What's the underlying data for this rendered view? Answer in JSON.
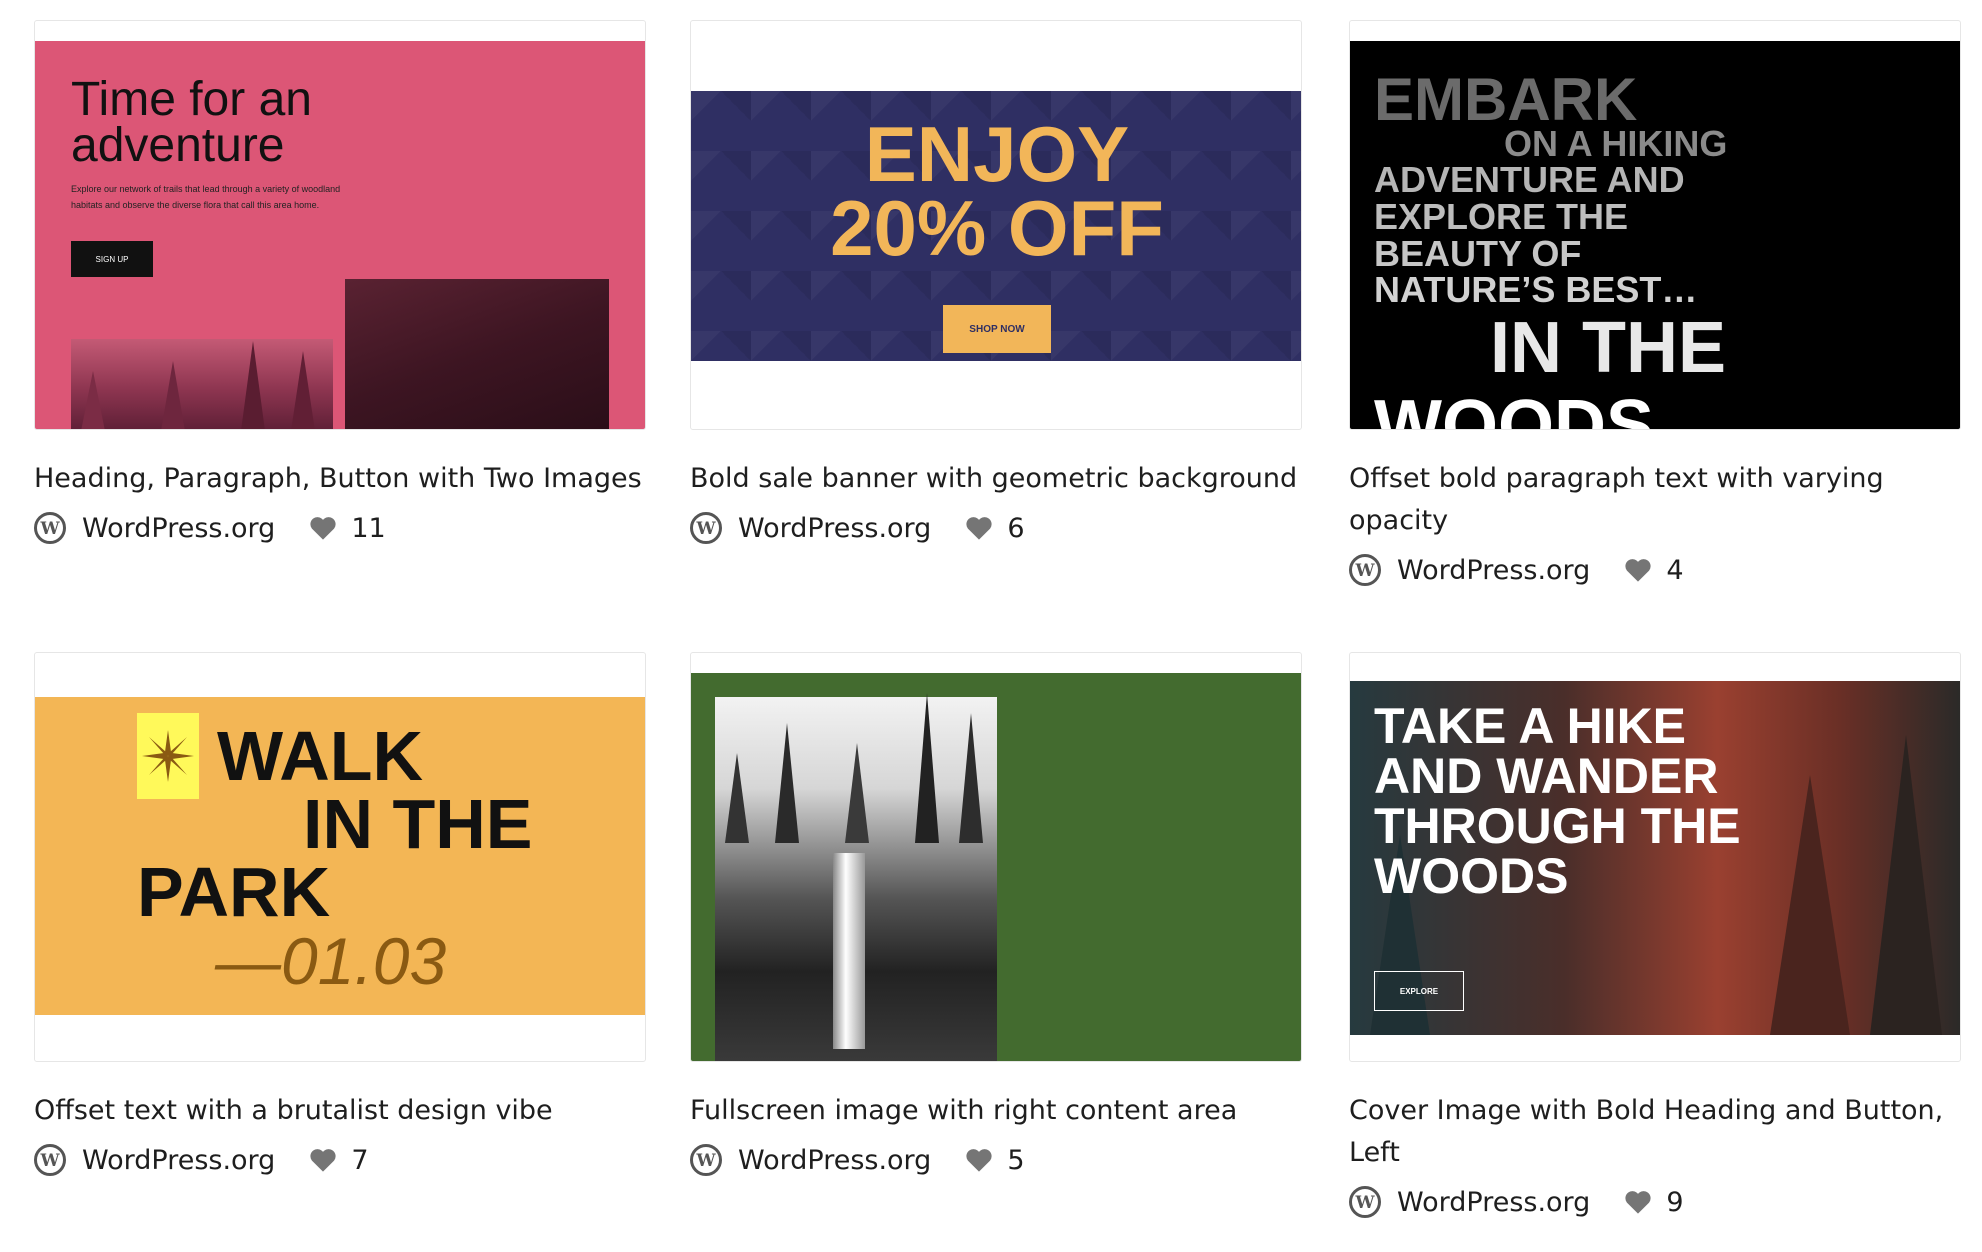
{
  "patterns": [
    {
      "title": "Heading, Paragraph, Button with Two Images",
      "author": "WordPress.org",
      "likes": "11",
      "preview": {
        "heading": "Time for an adventure",
        "paragraph": "Explore our network of trails that lead through a variety of woodland habitats and observe the diverse flora that call this area home.",
        "button": "SIGN UP"
      }
    },
    {
      "title": "Bold sale banner with geometric background",
      "author": "WordPress.org",
      "likes": "6",
      "preview": {
        "line1": "ENJOY",
        "line2": "20% OFF",
        "button": "SHOP NOW"
      }
    },
    {
      "title": "Offset bold paragraph text with varying opacity",
      "author": "WordPress.org",
      "likes": "4",
      "preview": {
        "line1": "EMBARK",
        "line2": "ON A HIKING",
        "line3": "ADVENTURE AND",
        "line4": "EXPLORE THE",
        "line5": "BEAUTY OF",
        "line6": "NATURE’S BEST…",
        "line7": "IN THE",
        "line8": "WOODS"
      }
    },
    {
      "title": "Offset text with a brutalist design vibe",
      "author": "WordPress.org",
      "likes": "7",
      "preview": {
        "line1": "WALK",
        "line2": "IN THE",
        "line3": "PARK",
        "line4": "—01.03"
      }
    },
    {
      "title": "Fullscreen image with right content area",
      "author": "WordPress.org",
      "likes": "5",
      "preview": {}
    },
    {
      "title": "Cover Image with Bold Heading and Button, Left",
      "author": "WordPress.org",
      "likes": "9",
      "preview": {
        "heading": "TAKE A HIKE AND WANDER THROUGH THE WOODS",
        "button": "EXPLORE"
      }
    }
  ],
  "colors": {
    "card1_bg": "#dc5676",
    "card2_bg": "#2f2f63",
    "card2_accent": "#f2b659",
    "card4_bg": "#f3b655",
    "card5_bg": "#436b2f"
  }
}
